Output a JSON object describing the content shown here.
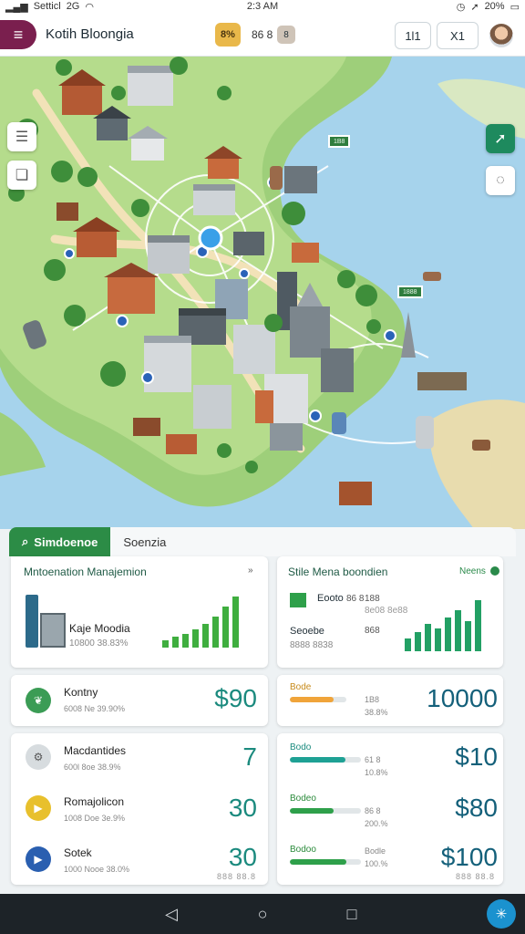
{
  "status_bar": {
    "carrier": "Setticl",
    "network": "2G",
    "time": "2:3 AM",
    "battery": "20%"
  },
  "header": {
    "app_title": "Kotih Bloongia",
    "logo_text": "8%",
    "code_text": "86 8",
    "pill_text": "8",
    "btn_a": "1l1",
    "btn_b": "X1",
    "avatar_icon": "user-avatar"
  },
  "map": {
    "tag_1": "1B8",
    "tag_2": "1888",
    "layers_icon": "menu-lines",
    "tools_icon": "stack-icon",
    "nav_icon": "arrow-diagonal",
    "compass_icon": "compass-ring"
  },
  "tabs": [
    {
      "label": "Simdoenoe",
      "active": true,
      "icon": "search-icon"
    },
    {
      "label": "Soenzia",
      "active": false
    }
  ],
  "card_left_top": {
    "title": "Mntoenation Manajemion",
    "more": "»",
    "label": "Kaje Moodia",
    "sub": "10800 38.83%",
    "bars": [
      14,
      20,
      26,
      34,
      44,
      58,
      78,
      96
    ],
    "color": "#3fae3f"
  },
  "card_right_top": {
    "title": "Stile Mena boondien",
    "badge": "Neens",
    "label_1": "Eooto",
    "sub_1": "86 8",
    "val_1": "188",
    "label_2": "Seoebe",
    "val_2": "868",
    "sub_2": "8e08 8e88",
    "sub_3": "8888 8838",
    "bars": [
      24,
      36,
      50,
      42,
      62,
      76,
      56,
      94
    ],
    "color": "#22a064"
  },
  "left_rows": [
    {
      "label": "Kontny",
      "sub": "6008 Ne 39.90%",
      "value": "$90",
      "icon_color": "#3b9c55",
      "icon": "leaf-icon"
    },
    {
      "label": "Macdantides",
      "sub": "600l 8oe 38.9%",
      "value": "7",
      "icon_color": "#d7dcdf",
      "icon": "gear-icon"
    },
    {
      "label": "Romajolicon",
      "sub": "1008 Doe 3e.9%",
      "value": "30",
      "icon_color": "#e8c02d",
      "icon": "play-icon"
    },
    {
      "label": "Sotek",
      "sub": "1000 Nooe 38.0%",
      "value": "30",
      "icon_color": "#2a5fb0",
      "icon": "play-icon"
    }
  ],
  "left_rows_foot": "888 88.8",
  "right_rows": [
    {
      "label": "Bode",
      "sub": "1B8",
      "sub2": "38.8%",
      "value": "10000",
      "fill": 0.78,
      "color": "#f0a43a"
    },
    {
      "label": "Bodo",
      "sub": "61 8",
      "sub2": "10.8%",
      "value": "$10",
      "fill": 0.78,
      "color": "#1ea194"
    },
    {
      "label": "Bodeo",
      "sub": "86 8",
      "sub2": "200.%",
      "value": "$80",
      "fill": 0.62,
      "color": "#2ea04a"
    },
    {
      "label": "Bodoo",
      "sub": "Bodle",
      "sub2": "100.%",
      "value": "$100",
      "fill": 0.8,
      "color": "#2ea04a"
    }
  ],
  "right_rows_foot": "888 88.8",
  "nav": {
    "back_icon": "back-triangle",
    "home_icon": "home-circle",
    "recent_icon": "recent-square",
    "fab_icon": "sparkle"
  }
}
